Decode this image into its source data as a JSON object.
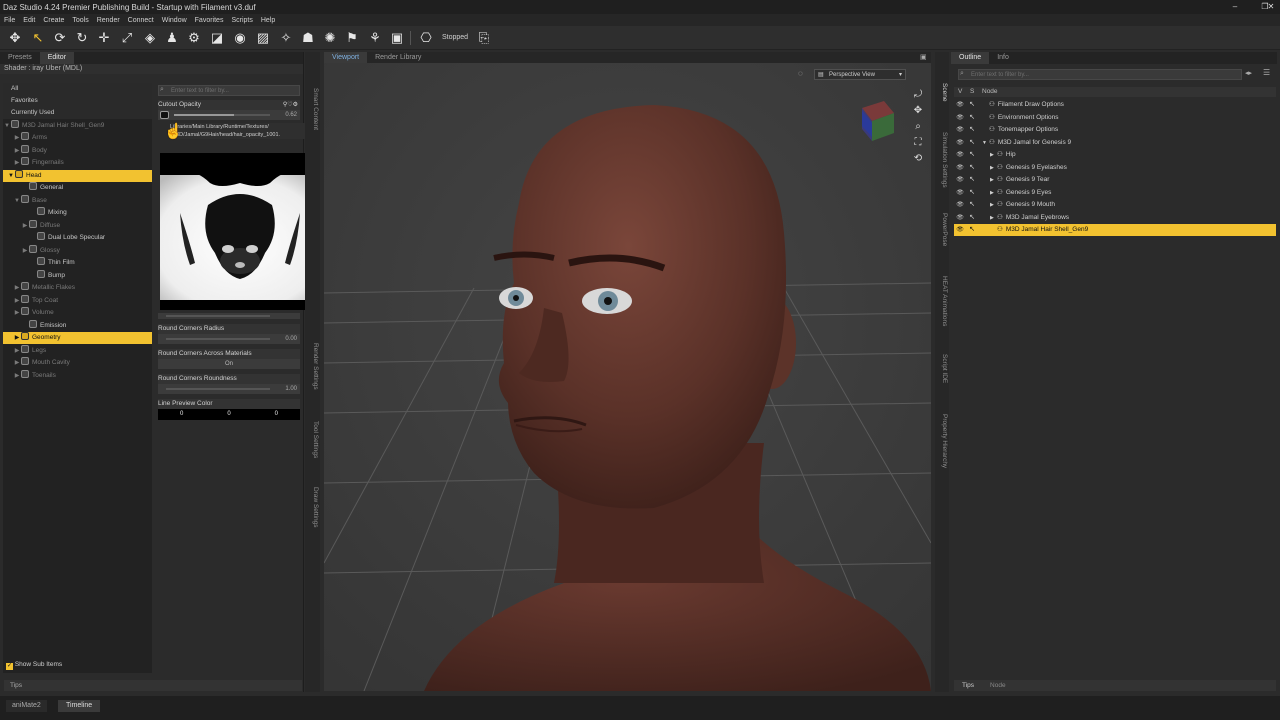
{
  "window": {
    "title": "Daz Studio 4.24 Premier Publishing Build - Startup with Filament v3.duf",
    "controls": [
      "–",
      "❐",
      "✕"
    ]
  },
  "menu": [
    "File",
    "Edit",
    "Create",
    "Tools",
    "Render",
    "Connect",
    "Window",
    "Favorites",
    "Scripts",
    "Help"
  ],
  "toolbar": {
    "status": "Stopped"
  },
  "left_panel": {
    "tabs": [
      "Presets",
      "Editor"
    ],
    "shader": "Shader : iray Uber (MDL)",
    "filters": [
      "All",
      "Favorites",
      "Currently Used"
    ],
    "root": "M3D Jamal Hair Shell_Gen9",
    "tree": [
      {
        "label": "Arms",
        "level": 1,
        "arrow": "▶",
        "state": "dim"
      },
      {
        "label": "Body",
        "level": 1,
        "arrow": "▶",
        "state": "dim"
      },
      {
        "label": "Fingernails",
        "level": 1,
        "arrow": "▶",
        "state": "dim"
      },
      {
        "label": "Head",
        "level": 0,
        "arrow": "▼",
        "state": "sel"
      },
      {
        "label": "General",
        "level": 2,
        "arrow": "",
        "state": ""
      },
      {
        "label": "Base",
        "level": 1,
        "arrow": "▼",
        "state": "dim"
      },
      {
        "label": "Mixing",
        "level": 3,
        "arrow": "",
        "state": ""
      },
      {
        "label": "Diffuse",
        "level": 2,
        "arrow": "▶",
        "state": "dim"
      },
      {
        "label": "Dual Lobe Specular",
        "level": 3,
        "arrow": "",
        "state": ""
      },
      {
        "label": "Glossy",
        "level": 2,
        "arrow": "▶",
        "state": "dim"
      },
      {
        "label": "Thin Film",
        "level": 3,
        "arrow": "",
        "state": ""
      },
      {
        "label": "Bump",
        "level": 3,
        "arrow": "",
        "state": ""
      },
      {
        "label": "Metallic Flakes",
        "level": 1,
        "arrow": "▶",
        "state": "dim"
      },
      {
        "label": "Top Coat",
        "level": 1,
        "arrow": "▶",
        "state": "dim"
      },
      {
        "label": "Volume",
        "level": 1,
        "arrow": "▶",
        "state": "dim"
      },
      {
        "label": "Emission",
        "level": 2,
        "arrow": "",
        "state": ""
      },
      {
        "label": "Geometry",
        "level": 1,
        "arrow": "▶",
        "state": "sel"
      },
      {
        "label": "Legs",
        "level": 1,
        "arrow": "▶",
        "state": "dim"
      },
      {
        "label": "Mouth Cavity",
        "level": 1,
        "arrow": "▶",
        "state": "dim"
      },
      {
        "label": "Toenails",
        "level": 1,
        "arrow": "▶",
        "state": "dim"
      }
    ],
    "show_sub_items": "Show Sub Items",
    "tips": "Tips"
  },
  "properties": {
    "search_placeholder": "Enter text to filter by...",
    "cutout_label": "Cutout Opacity",
    "cutout_value": "0.62",
    "cutout_fill": 0.62,
    "map_path_1": "Libraries/Main Library/Runtime/Textures/",
    "map_path_2": "/M3D/Jamal/G9Hair/head/hair_opacity_1001.",
    "round_corners_radius": "Round Corners Radius",
    "round_corners_radius_value": "0.00",
    "round_corners_across": "Round Corners Across Materials",
    "round_corners_across_value": "On",
    "round_corners_roundness": "Round Corners Roundness",
    "round_corners_roundness_value": "1.00",
    "line_preview_color": "Line Preview Color",
    "line_preview_values": [
      "0",
      "0",
      "0"
    ]
  },
  "side_tabs_left": [
    "Smart Content",
    "Render Settings",
    "Tool Settings",
    "Draw Settings"
  ],
  "viewport": {
    "tabs": [
      "Viewport",
      "Render Library"
    ],
    "view_select": "Perspective View"
  },
  "side_tabs_right": [
    "Scene",
    "Simulation Settings",
    "PowerPose",
    "HEAT Animations",
    "Script IDE",
    "Property Hierarchy"
  ],
  "right_panel": {
    "tabs": [
      "Outline",
      "Info"
    ],
    "search_placeholder": "Enter text to filter by...",
    "cols": [
      "V",
      "S",
      "Node"
    ],
    "nodes": [
      {
        "label": "Filament Draw Options",
        "indent": 0,
        "arrow": "",
        "state": ""
      },
      {
        "label": "Environment Options",
        "indent": 0,
        "arrow": "",
        "state": ""
      },
      {
        "label": "Tonemapper Options",
        "indent": 0,
        "arrow": "",
        "state": ""
      },
      {
        "label": "M3D Jamal for Genesis 9",
        "indent": 0,
        "arrow": "▼",
        "state": ""
      },
      {
        "label": "Hip",
        "indent": 1,
        "arrow": "▶",
        "state": ""
      },
      {
        "label": "Genesis 9 Eyelashes",
        "indent": 1,
        "arrow": "▶",
        "state": ""
      },
      {
        "label": "Genesis 9 Tear",
        "indent": 1,
        "arrow": "▶",
        "state": ""
      },
      {
        "label": "Genesis 9 Eyes",
        "indent": 1,
        "arrow": "▶",
        "state": ""
      },
      {
        "label": "Genesis 9 Mouth",
        "indent": 1,
        "arrow": "▶",
        "state": ""
      },
      {
        "label": "M3D Jamal Eyebrows",
        "indent": 1,
        "arrow": "▶",
        "state": ""
      },
      {
        "label": "M3D Jamal Hair Shell_Gen9",
        "indent": 1,
        "arrow": "",
        "state": "sel"
      }
    ],
    "bottom_tabs": [
      "Tips",
      "Node"
    ]
  },
  "bottom_tabs": [
    "aniMate2",
    "Timeline"
  ],
  "colors": {
    "accent": "#f2c230",
    "panel": "#2b2b2b",
    "viewport_bg": "#3d3d3d",
    "skin": "#5a3128"
  }
}
